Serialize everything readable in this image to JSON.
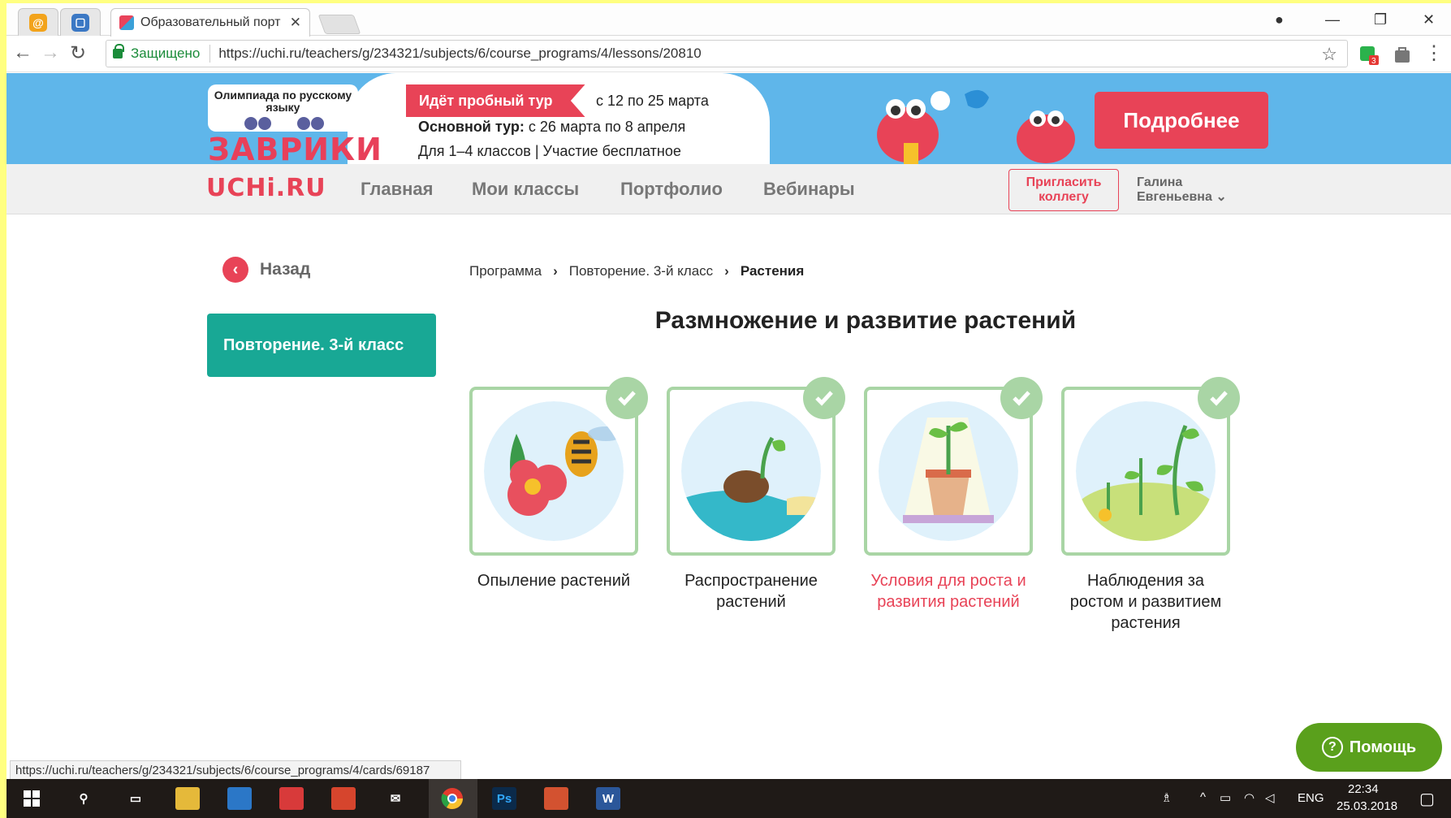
{
  "browser": {
    "tab_title": "Образовательный порт",
    "secure_label": "Защищено",
    "url": "https://uchi.ru/teachers/g/234321/subjects/6/course_programs/4/lessons/20810",
    "status_url": "https://uchi.ru/teachers/g/234321/subjects/6/course_programs/4/cards/69187"
  },
  "banner": {
    "olympiad_line1": "Олимпиада по русскому",
    "olympiad_line2": "языку",
    "logo_text": "ЗАВРИКИ",
    "trial_tour": "Идёт пробный тур",
    "trial_dates": "с 12 по 25 марта",
    "main_tour_label": "Основной тур:",
    "main_tour_dates": " с 26 марта по 8 апреля",
    "grades": "Для 1–4 классов | Участие бесплатное",
    "more_button": "Подробнее"
  },
  "nav": {
    "logo": "UCHi.RU",
    "links": [
      "Главная",
      "Мои классы",
      "Портфолио",
      "Вебинары"
    ],
    "invite_line1": "Пригласить",
    "invite_line2": "коллегу",
    "user_first": "Галина",
    "user_last": "Евгеньевна"
  },
  "sidebar": {
    "back_label": "Назад",
    "course_card": "Повторение. 3-й класс"
  },
  "breadcrumb": [
    "Программа",
    "Повторение. 3-й класс",
    "Растения"
  ],
  "page_title": "Размножение и развитие растений",
  "cards": [
    {
      "label": "Опыление растений",
      "completed": true
    },
    {
      "label": "Распространение растений",
      "completed": true
    },
    {
      "label": "Условия для роста и развития растений",
      "completed": true,
      "highlighted": true
    },
    {
      "label": "Наблюдения за ростом и развитием растения",
      "completed": true
    }
  ],
  "help_button": "Помощь",
  "taskbar": {
    "language": "ENG",
    "time": "22:34",
    "date": "25.03.2018",
    "badge_count": "3"
  },
  "colors": {
    "accent": "#e84357",
    "teal": "#18a895",
    "check_green": "#a9d5a5",
    "help_green": "#5aa01c",
    "banner_blue": "#5fb6ea"
  }
}
